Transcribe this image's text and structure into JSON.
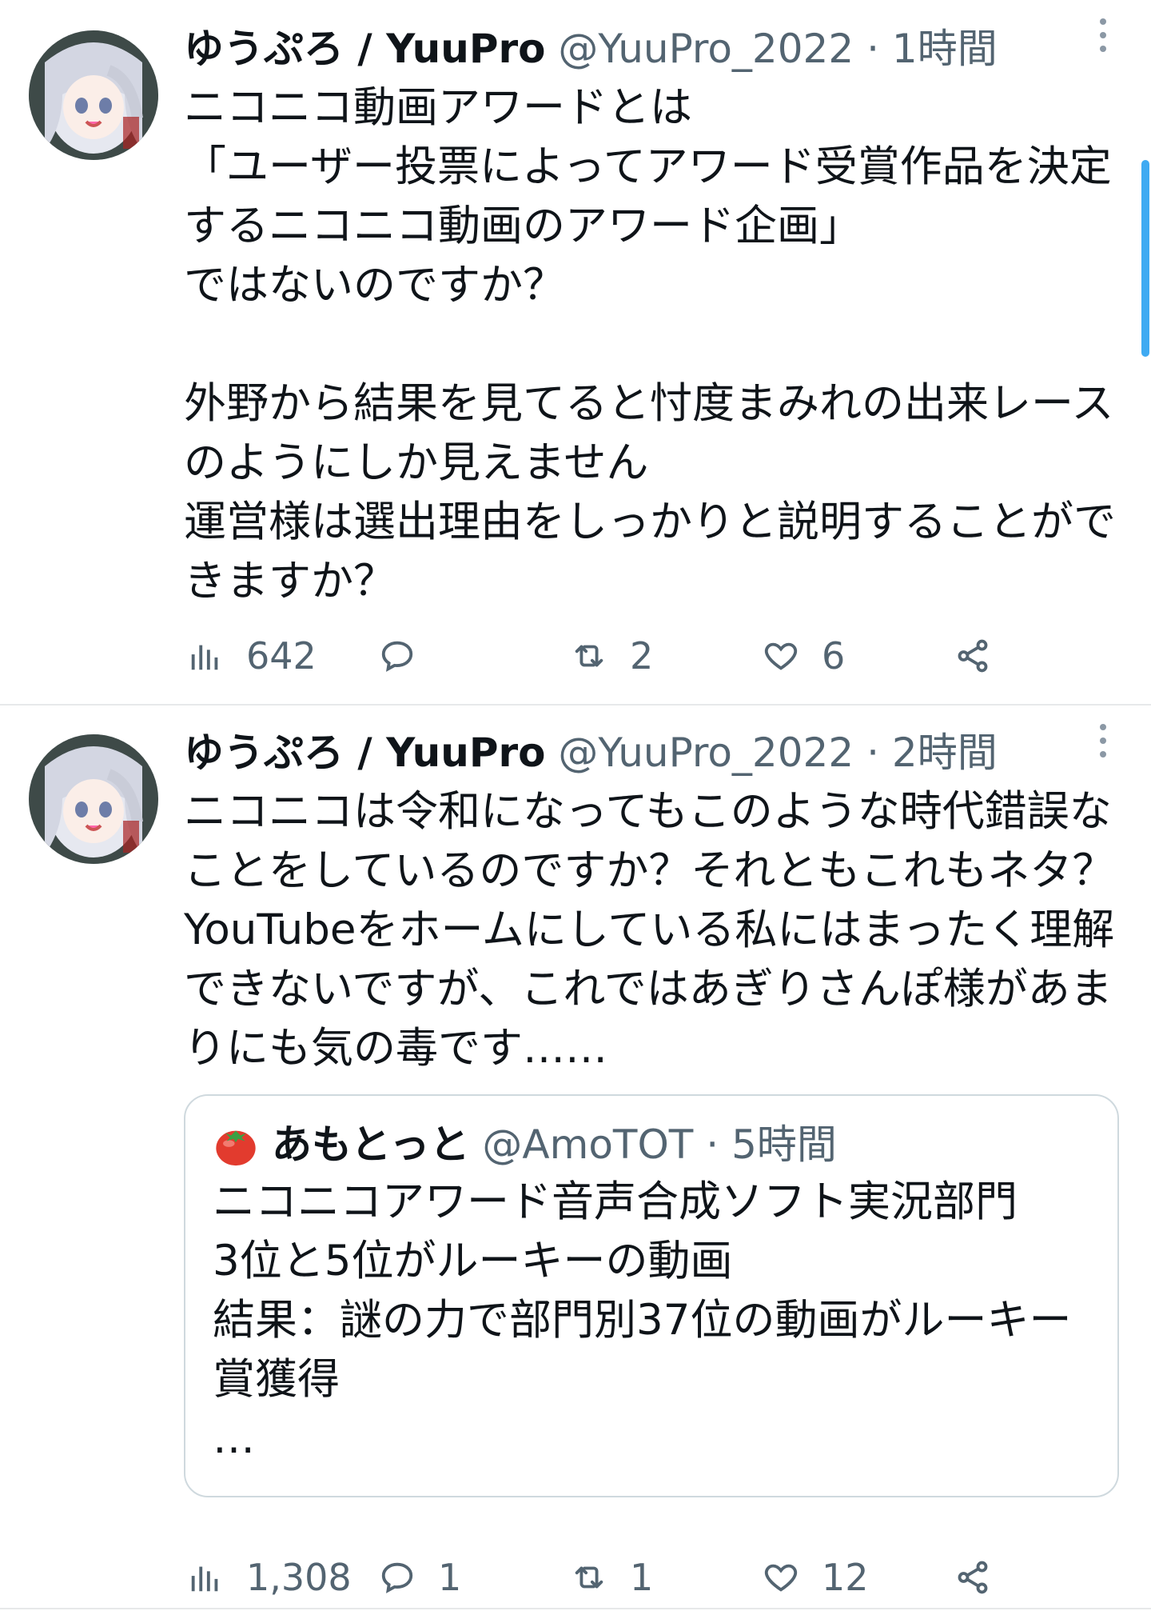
{
  "tweets": [
    {
      "author_name": "ゆうぷろ / YuuPro",
      "handle": "@YuuPro_2022",
      "separator": "·",
      "time": "1時間",
      "lines": [
        "ニコニコ動画アワードとは",
        "「ユーザー投票によってアワード受賞作品を決定",
        "するニコニコ動画のアワード企画」",
        "ではないのですか？",
        "",
        "外野から結果を見てると忖度まみれの出来レース",
        "のようにしか見えません",
        "運営様は選出理由をしっかりと説明することがで",
        "きますか？"
      ],
      "stats": {
        "views": "642",
        "replies": "",
        "retweets": "2",
        "likes": "6"
      }
    },
    {
      "author_name": "ゆうぷろ / YuuPro",
      "handle": "@YuuPro_2022",
      "separator": "·",
      "time": "2時間",
      "lines": [
        "ニコニコは令和になってもこのような時代錯誤な",
        "ことをしているのですか？それともこれもネタ？",
        "YouTubeをホームにしている私にはまったく理解",
        "できないですが、これではあぎりさんぽ様があま",
        "りにも気の毒です……"
      ],
      "quote": {
        "author_name": "あもとっと",
        "handle": "@AmoTOT",
        "separator": "·",
        "time": "5時間",
        "lines": [
          "ニコニコアワード音声合成ソフト実況部門",
          "3位と5位がルーキーの動画",
          "結果：謎の力で部門別37位の動画がルーキー",
          "賞獲得",
          "…"
        ]
      },
      "stats": {
        "views": "1,308",
        "replies": "1",
        "retweets": "1",
        "likes": "12"
      }
    }
  ],
  "icons": {
    "avatar": "anime-character-avatar",
    "quote_avatar": "tomato-icon",
    "more": "more-vertical-icon",
    "views": "bar-chart-icon",
    "reply": "reply-bubble-icon",
    "retweet": "retweet-icon",
    "like": "heart-icon",
    "share": "share-icon"
  },
  "colors": {
    "text": "#0f1419",
    "secondary": "#536471",
    "border": "#cfd9de",
    "accent": "#1d9bf0"
  }
}
